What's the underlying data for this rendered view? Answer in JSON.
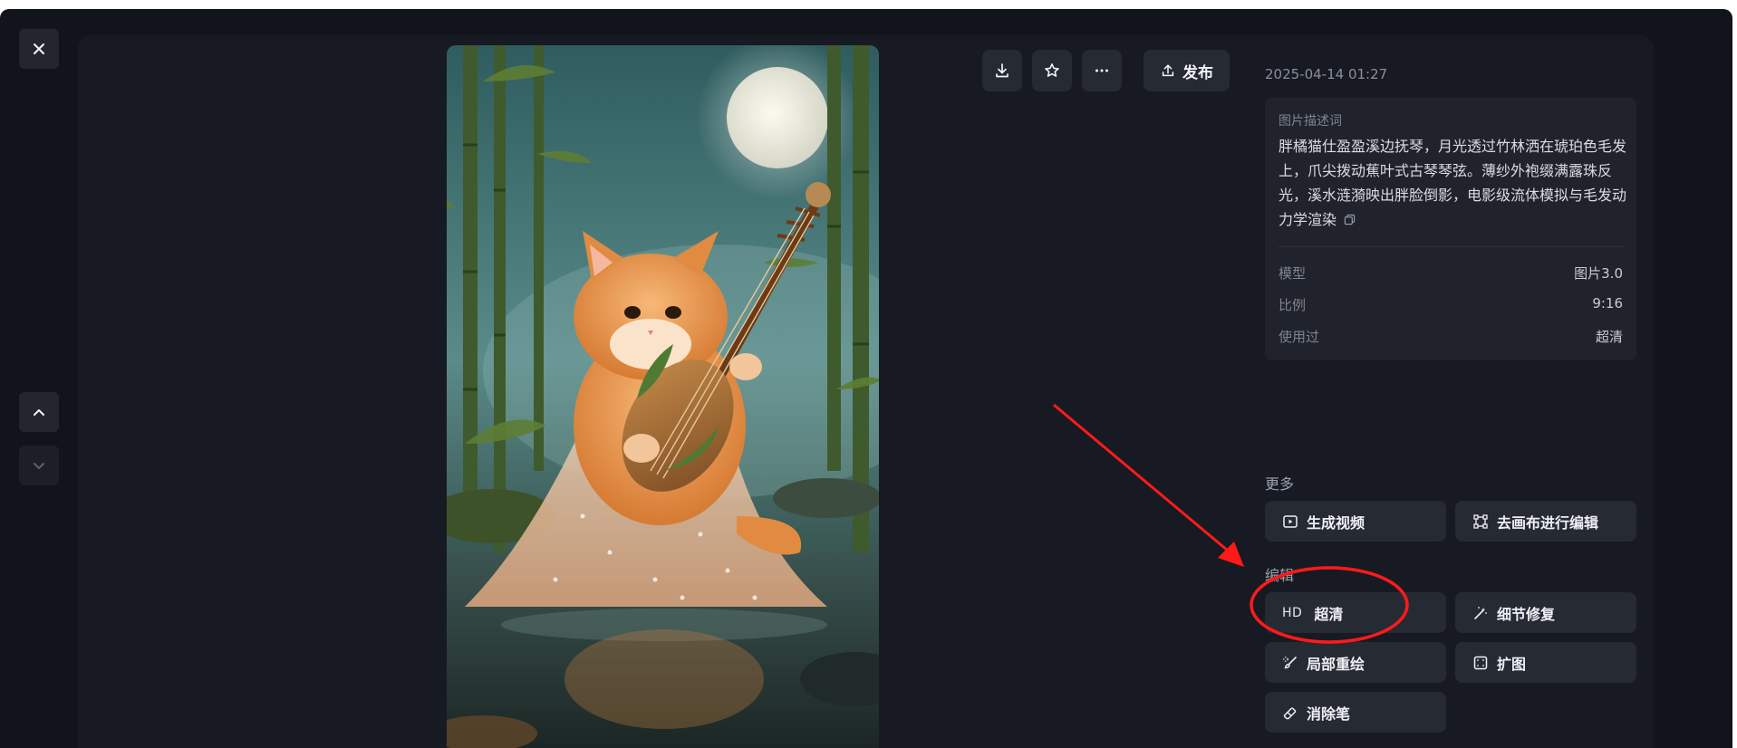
{
  "date": "2025-04-14 01:27",
  "toolbar": {
    "download_icon": "download-icon",
    "favorite_icon": "star-icon",
    "more_icon": "more-icon",
    "publish_label": "发布"
  },
  "info": {
    "label": "图片描述词",
    "prompt": "胖橘猫仕盈盈溪边抚琴，月光透过竹林洒在琥珀色毛发上，爪尖拨动蕉叶式古琴琴弦。薄纱外袍缀满露珠反光，溪水涟漪映出胖脸倒影，电影级流体模拟与毛发动力学渲染",
    "rows": [
      {
        "key": "模型",
        "value": "图片3.0"
      },
      {
        "key": "比例",
        "value": "9:16"
      },
      {
        "key": "使用过",
        "value": "超清"
      }
    ]
  },
  "more": {
    "title": "更多",
    "generate_video": "生成视频",
    "edit_canvas": "去画布进行编辑"
  },
  "edit": {
    "title": "编辑",
    "hd_badge": "HD",
    "hd_label": "超清",
    "detail_fix": "细节修复",
    "inpaint": "局部重绘",
    "expand": "扩图",
    "eraser": "消除笔"
  },
  "annotation": {
    "arrow_color": "#ff1a1a",
    "circle_color": "#ff1a1a"
  },
  "colors": {
    "background": "#12141b",
    "panel": "#171a22",
    "button": "#262a33",
    "card": "#20232c"
  }
}
